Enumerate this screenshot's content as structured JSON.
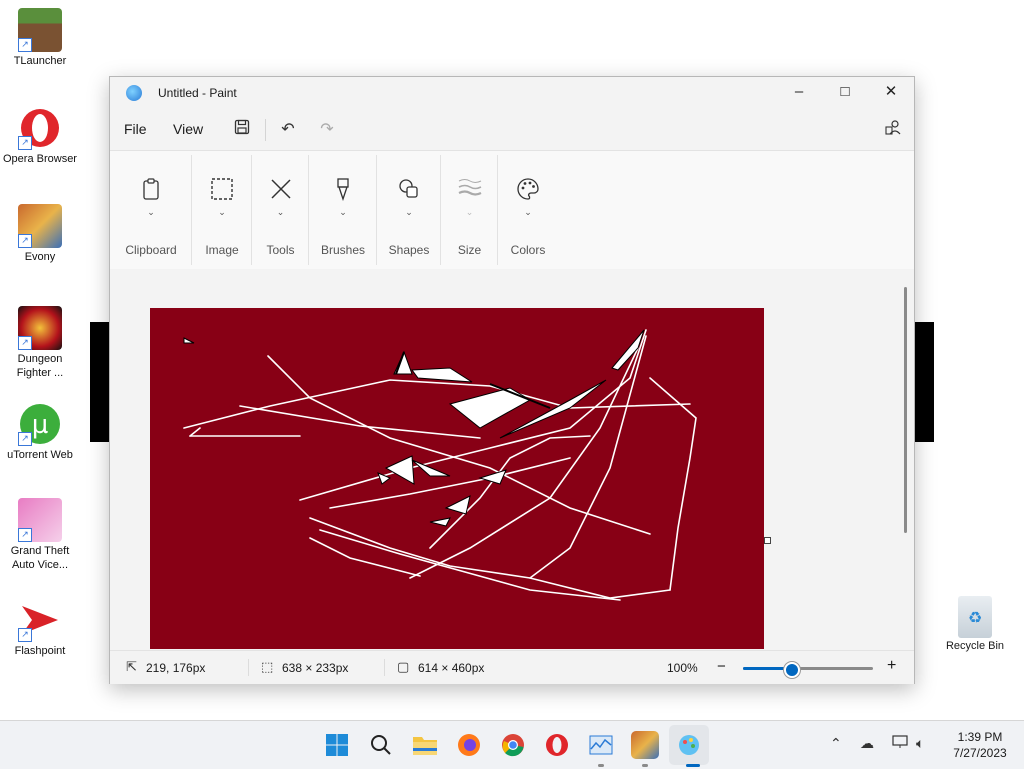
{
  "desktop": {
    "icons": [
      {
        "label": "TLauncher",
        "icon": "minecraft-block-icon",
        "color": "#5a8f3c"
      },
      {
        "label": "Opera Browser",
        "icon": "opera-icon",
        "color": "#e0262b"
      },
      {
        "label": "Evony",
        "icon": "evony-icon",
        "color": "#c9692e"
      },
      {
        "label": "Dungeon Fighter ...",
        "icon": "dungeon-fighter-icon",
        "color": "#b3121b"
      },
      {
        "label": "uTorrent Web",
        "icon": "utorrent-icon",
        "color": "#3cae3c"
      },
      {
        "label": "Grand Theft Auto Vice...",
        "icon": "gta-vice-city-icon",
        "color": "#e87cc3"
      },
      {
        "label": "Flashpoint",
        "icon": "flashpoint-icon",
        "color": "#d92228"
      }
    ],
    "recycle_bin": {
      "label": "Recycle Bin",
      "icon": "recycle-bin-icon"
    }
  },
  "window": {
    "title": "Untitled - Paint",
    "app_icon": "paint-icon",
    "controls": {
      "minimize": "–",
      "maximize": "□",
      "close": "✕"
    }
  },
  "menubar": {
    "file": "File",
    "view": "View",
    "save_icon": "save-icon",
    "undo_icon": "undo-icon",
    "redo_icon": "redo-icon",
    "account_icon": "account-icon"
  },
  "ribbon": {
    "groups": [
      {
        "label": "Clipboard",
        "icon": "clipboard-icon"
      },
      {
        "label": "Image",
        "icon": "selection-icon"
      },
      {
        "label": "Tools",
        "icon": "tools-icon"
      },
      {
        "label": "Brushes",
        "icon": "brush-icon"
      },
      {
        "label": "Shapes",
        "icon": "shapes-icon"
      },
      {
        "label": "Size",
        "icon": "size-icon"
      },
      {
        "label": "Colors",
        "icon": "palette-icon"
      }
    ]
  },
  "canvas": {
    "background_color": "#880015",
    "stroke_color": "#ffffff"
  },
  "status": {
    "cursor_position": "219, 176px",
    "selection_size": "638 × 233px",
    "canvas_size": "614 × 460px",
    "zoom": "100%",
    "zoom_minus": "−",
    "zoom_plus": "+",
    "zoom_level_fraction": 0.38,
    "accent": "#0067c0"
  },
  "taskbar": {
    "apps": [
      "start-icon",
      "search-icon",
      "file-explorer-icon",
      "firefox-icon",
      "chrome-icon",
      "opera-icon",
      "task-manager-icon",
      "evony-icon",
      "paint-icon"
    ],
    "clock_time": "1:39 PM",
    "clock_date": "7/27/2023"
  }
}
